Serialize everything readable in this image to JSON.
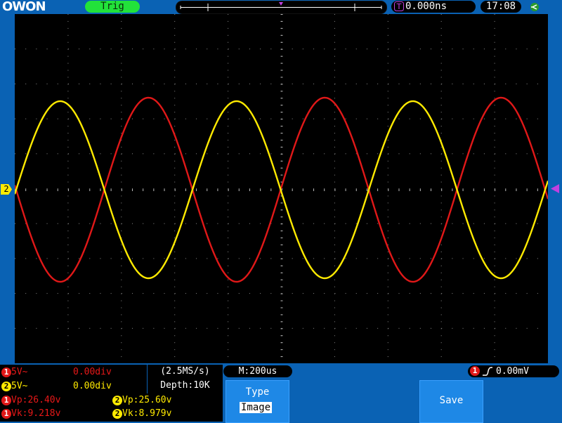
{
  "header": {
    "brand": "OWON",
    "trigger_status": "Trig",
    "trigger_position": "0.000ns",
    "clock": "17:08",
    "trigger_marker": "T",
    "usb_icon": "usb-icon"
  },
  "screen": {
    "ch2_marker": "2",
    "channel_colors": {
      "ch1": "#e01818",
      "ch2": "#ffea00"
    }
  },
  "channels": [
    {
      "id": "1",
      "scale": "5V~",
      "position": "0.00div"
    },
    {
      "id": "2",
      "scale": "5V~",
      "position": "0.00div"
    }
  ],
  "acquisition": {
    "sample_rate": "(2.5MS/s)",
    "depth": "Depth:10K"
  },
  "measurements": {
    "ch1_vp": "Vp:26.40v",
    "ch1_vk": "Vk:9.218v",
    "ch2_vp": "Vp:25.60v",
    "ch2_vk": "Vk:8.979v"
  },
  "timebase": "M:200us",
  "trigger": {
    "channel": "1",
    "level": "0.00mV"
  },
  "menu": {
    "type_label": "Type",
    "type_value": "Image",
    "save_label": "Save"
  }
}
